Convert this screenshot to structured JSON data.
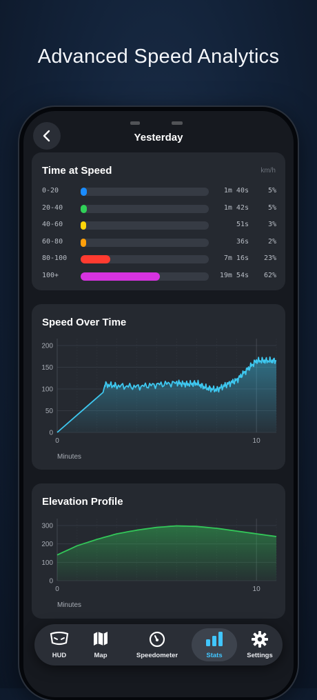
{
  "headline": "Advanced Speed Analytics",
  "header": {
    "title": "Yesterday"
  },
  "time_at_speed": {
    "title": "Time at Speed",
    "unit": "km/h",
    "rows": [
      {
        "range": "0-20",
        "time": "1m 40s",
        "pct": "5%",
        "fraction": 0.05,
        "color": "#1a8cff"
      },
      {
        "range": "20-40",
        "time": "1m 42s",
        "pct": "5%",
        "fraction": 0.05,
        "color": "#30d158"
      },
      {
        "range": "40-60",
        "time": "51s",
        "pct": "3%",
        "fraction": 0.03,
        "color": "#ffd60a"
      },
      {
        "range": "60-80",
        "time": "36s",
        "pct": "2%",
        "fraction": 0.02,
        "color": "#ff9f0a"
      },
      {
        "range": "80-100",
        "time": "7m 16s",
        "pct": "23%",
        "fraction": 0.23,
        "color": "#ff3b30"
      },
      {
        "range": "100+",
        "time": "19m 54s",
        "pct": "62%",
        "fraction": 0.62,
        "color": "#d633e0"
      }
    ]
  },
  "chart_data": [
    {
      "type": "area",
      "title": "Speed Over Time",
      "xlabel": "Minutes",
      "ylabel": "",
      "x_ticks": [
        "0",
        "10"
      ],
      "y_ticks": [
        "200",
        "150",
        "100",
        "50",
        "0"
      ],
      "xlim": [
        0,
        11
      ],
      "ylim": [
        0,
        200
      ],
      "grid": true,
      "color": "#3ec8f0",
      "x": [
        0,
        2.3,
        2.4,
        3,
        4,
        5,
        6,
        6.5,
        7,
        7.5,
        8,
        8.5,
        9,
        9.5,
        10,
        10.5,
        11
      ],
      "y": [
        0,
        92,
        110,
        107,
        105,
        110,
        114,
        111,
        113,
        102,
        98,
        110,
        120,
        143,
        165,
        165,
        165
      ]
    },
    {
      "type": "area",
      "title": "Elevation Profile",
      "xlabel": "Minutes",
      "ylabel": "",
      "x_ticks": [
        "0",
        "10"
      ],
      "y_ticks": [
        "300",
        "200",
        "100",
        "0"
      ],
      "xlim": [
        0,
        11
      ],
      "ylim": [
        0,
        300
      ],
      "grid": true,
      "color": "#33c759",
      "x": [
        0,
        1,
        2,
        3,
        4,
        5,
        6,
        7,
        8,
        9,
        10,
        11
      ],
      "y": [
        140,
        190,
        225,
        255,
        275,
        290,
        298,
        295,
        285,
        270,
        255,
        240
      ]
    }
  ],
  "tabbar": {
    "items": [
      {
        "label": "HUD",
        "icon": "hud-icon"
      },
      {
        "label": "Map",
        "icon": "map-icon"
      },
      {
        "label": "Speedometer",
        "icon": "speedometer-icon"
      },
      {
        "label": "Stats",
        "icon": "stats-icon",
        "active": true
      },
      {
        "label": "Settings",
        "icon": "gear-icon"
      }
    ]
  }
}
